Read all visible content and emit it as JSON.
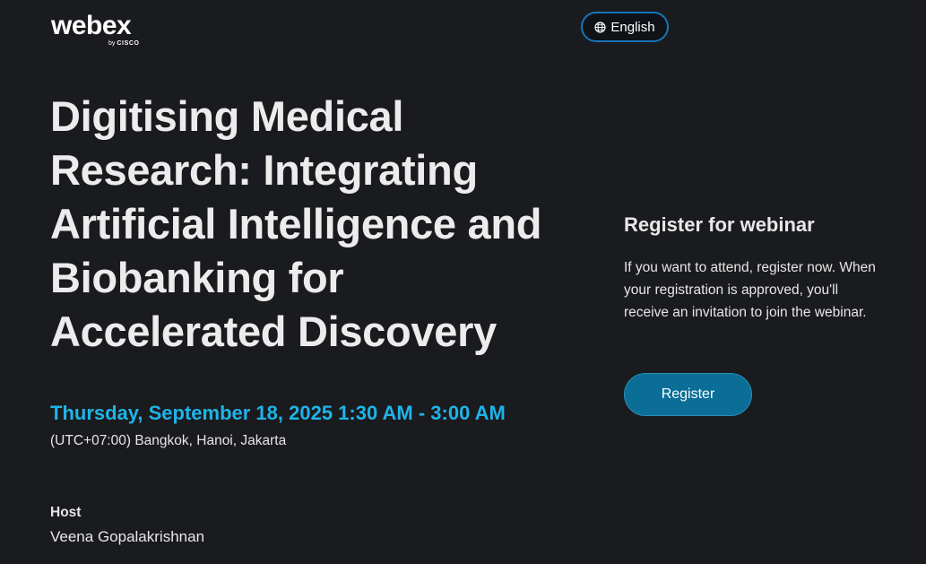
{
  "brand": {
    "logo_word": "webex",
    "logo_by": "by",
    "logo_cisco": "CISCO"
  },
  "language": {
    "label": "English",
    "icon": "globe-icon"
  },
  "event": {
    "title": "Digitising Medical Research: Integrating Artificial Intelligence and Biobanking for Accelerated Discovery",
    "date_time": "Thursday, September 18, 2025 1:30 AM - 3:00 AM",
    "timezone": "(UTC+07:00) Bangkok, Hanoi, Jakarta",
    "host_label": "Host",
    "host_name": "Veena Gopalakrishnan"
  },
  "register": {
    "heading": "Register for webinar",
    "description": "If you want to attend, register now. When your registration is approved, you'll receive an invitation to join the webinar.",
    "button_label": "Register"
  },
  "colors": {
    "background": "#1a1b1e",
    "accent_date": "#1fb4e8",
    "button": "#0a6e97",
    "lang_border": "#1a74b8"
  }
}
